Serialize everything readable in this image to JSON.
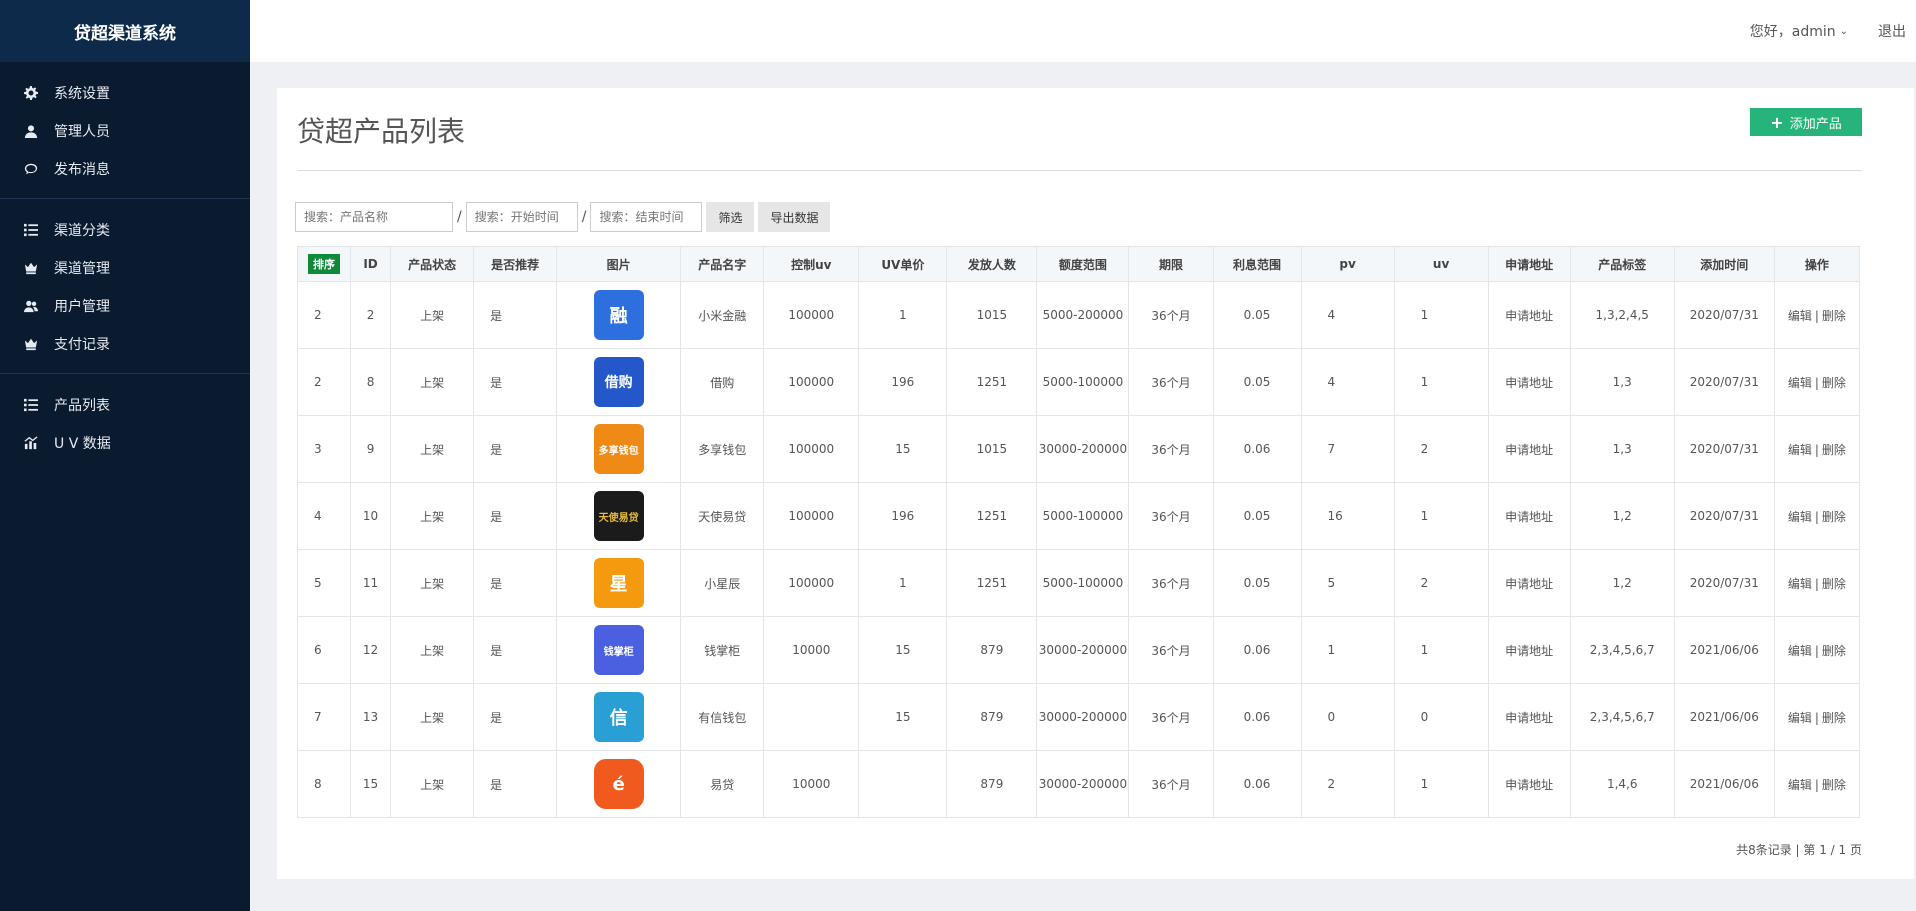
{
  "app": {
    "title": "贷超渠道系统"
  },
  "header": {
    "greeting": "您好，admin",
    "logout_label": "退出"
  },
  "sidebar": {
    "groups": [
      [
        {
          "label": "系统设置",
          "icon": "gear-icon"
        },
        {
          "label": "管理人员",
          "icon": "user-icon"
        },
        {
          "label": "发布消息",
          "icon": "chat-icon"
        }
      ],
      [
        {
          "label": "渠道分类",
          "icon": "list-icon"
        },
        {
          "label": "渠道管理",
          "icon": "crown-icon"
        },
        {
          "label": "用户管理",
          "icon": "users-icon"
        },
        {
          "label": "支付记录",
          "icon": "crown-icon"
        }
      ],
      [
        {
          "label": "产品列表",
          "icon": "list-icon"
        },
        {
          "label": "U V 数据",
          "icon": "bar-chart-icon"
        }
      ]
    ]
  },
  "page": {
    "title": "贷超产品列表",
    "add_label": "添加产品"
  },
  "filters": {
    "name_placeholder": "搜索：产品名称",
    "start_placeholder": "搜索：开始时间",
    "end_placeholder": "搜索：结束时间",
    "separator": "/",
    "filter_label": "筛选",
    "export_label": "导出数据"
  },
  "table": {
    "headers": [
      "排序",
      "ID",
      "产品状态",
      "是否推荐",
      "图片",
      "产品名字",
      "控制uv",
      "UV单价",
      "发放人数",
      "额度范围",
      "期限",
      "利息范围",
      "pv",
      "uv",
      "申请地址",
      "产品标签",
      "添加时间",
      "操作"
    ],
    "rows": [
      {
        "sort": "2",
        "id": "2",
        "status": "上架",
        "recommend": "是",
        "image": {
          "text": "融",
          "style": "t-blue"
        },
        "name": "小米金融",
        "ctrl_uv": "100000",
        "uv_price": "1",
        "count": "1015",
        "range": "5000-200000",
        "term": "36个月",
        "interest": "0.05",
        "pv": "4",
        "uv": "1",
        "apply": "申请地址",
        "tags": "1,3,2,4,5",
        "date": "2020/07/31",
        "edit": "编辑",
        "sep": "|",
        "del": "删除"
      },
      {
        "sort": "2",
        "id": "8",
        "status": "上架",
        "recommend": "是",
        "image": {
          "text": "借购",
          "style": "t-blue2"
        },
        "name": "借购",
        "ctrl_uv": "100000",
        "uv_price": "196",
        "count": "1251",
        "range": "5000-100000",
        "term": "36个月",
        "interest": "0.05",
        "pv": "4",
        "uv": "1",
        "apply": "申请地址",
        "tags": "1,3",
        "date": "2020/07/31",
        "edit": "编辑",
        "sep": "|",
        "del": "删除"
      },
      {
        "sort": "3",
        "id": "9",
        "status": "上架",
        "recommend": "是",
        "image": {
          "text": "多享钱包",
          "style": "t-orange"
        },
        "name": "多享钱包",
        "ctrl_uv": "100000",
        "uv_price": "15",
        "count": "1015",
        "range": "30000-200000",
        "term": "36个月",
        "interest": "0.06",
        "pv": "7",
        "uv": "2",
        "apply": "申请地址",
        "tags": "1,3",
        "date": "2020/07/31",
        "edit": "编辑",
        "sep": "|",
        "del": "删除"
      },
      {
        "sort": "4",
        "id": "10",
        "status": "上架",
        "recommend": "是",
        "image": {
          "text": "天使易贷",
          "style": "t-dark"
        },
        "name": "天使易贷",
        "ctrl_uv": "100000",
        "uv_price": "196",
        "count": "1251",
        "range": "5000-100000",
        "term": "36个月",
        "interest": "0.05",
        "pv": "16",
        "uv": "1",
        "apply": "申请地址",
        "tags": "1,2",
        "date": "2020/07/31",
        "edit": "编辑",
        "sep": "|",
        "del": "删除"
      },
      {
        "sort": "5",
        "id": "11",
        "status": "上架",
        "recommend": "是",
        "image": {
          "text": "星",
          "style": "t-amber"
        },
        "name": "小星辰",
        "ctrl_uv": "100000",
        "uv_price": "1",
        "count": "1251",
        "range": "5000-100000",
        "term": "36个月",
        "interest": "0.05",
        "pv": "5",
        "uv": "2",
        "apply": "申请地址",
        "tags": "1,2",
        "date": "2020/07/31",
        "edit": "编辑",
        "sep": "|",
        "del": "删除"
      },
      {
        "sort": "6",
        "id": "12",
        "status": "上架",
        "recommend": "是",
        "image": {
          "text": "钱掌柜",
          "style": "t-purple"
        },
        "name": "钱掌柜",
        "ctrl_uv": "10000",
        "uv_price": "15",
        "count": "879",
        "range": "30000-200000",
        "term": "36个月",
        "interest": "0.06",
        "pv": "1",
        "uv": "1",
        "apply": "申请地址",
        "tags": "2,3,4,5,6,7",
        "date": "2021/06/06",
        "edit": "编辑",
        "sep": "|",
        "del": "删除"
      },
      {
        "sort": "7",
        "id": "13",
        "status": "上架",
        "recommend": "是",
        "image": {
          "text": "信",
          "style": "t-cyan"
        },
        "name": "有信钱包",
        "ctrl_uv": "",
        "uv_price": "15",
        "count": "879",
        "range": "30000-200000",
        "term": "36个月",
        "interest": "0.06",
        "pv": "0",
        "uv": "0",
        "apply": "申请地址",
        "tags": "2,3,4,5,6,7",
        "date": "2021/06/06",
        "edit": "编辑",
        "sep": "|",
        "del": "删除"
      },
      {
        "sort": "8",
        "id": "15",
        "status": "上架",
        "recommend": "是",
        "image": {
          "text": "é",
          "style": "t-red"
        },
        "name": "易贷",
        "ctrl_uv": "10000",
        "uv_price": "",
        "count": "879",
        "range": "30000-200000",
        "term": "36个月",
        "interest": "0.06",
        "pv": "2",
        "uv": "1",
        "apply": "申请地址",
        "tags": "1,4,6",
        "date": "2021/06/06",
        "edit": "编辑",
        "sep": "|",
        "del": "删除"
      }
    ]
  },
  "pagination": {
    "text": "共8条记录 | 第 1 / 1 页"
  }
}
